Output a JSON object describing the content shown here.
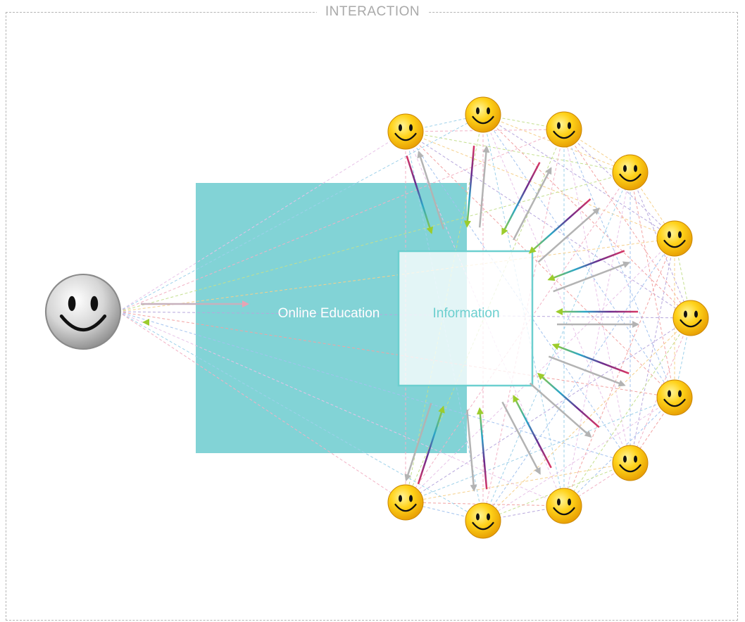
{
  "frame": {
    "title": "INTERACTION"
  },
  "blocks": {
    "education_label": "Online Education",
    "information_label": "Information"
  },
  "colors": {
    "frame_border": "#b4b4b4",
    "frame_title": "#a9a9a9",
    "education_fill": "#82d3d6",
    "information_border": "#6ccfcf",
    "information_text": "#6ccfcf",
    "arrow_gray": "#b3b3b3",
    "smiley_yellow": "#f7c300",
    "teacher_silver": "#bdbdbd"
  },
  "nodes": {
    "teacher": {
      "icon": "teacher-smiley-icon"
    },
    "learners": {
      "icon": "learner-smiley-icon",
      "count": 12
    }
  }
}
